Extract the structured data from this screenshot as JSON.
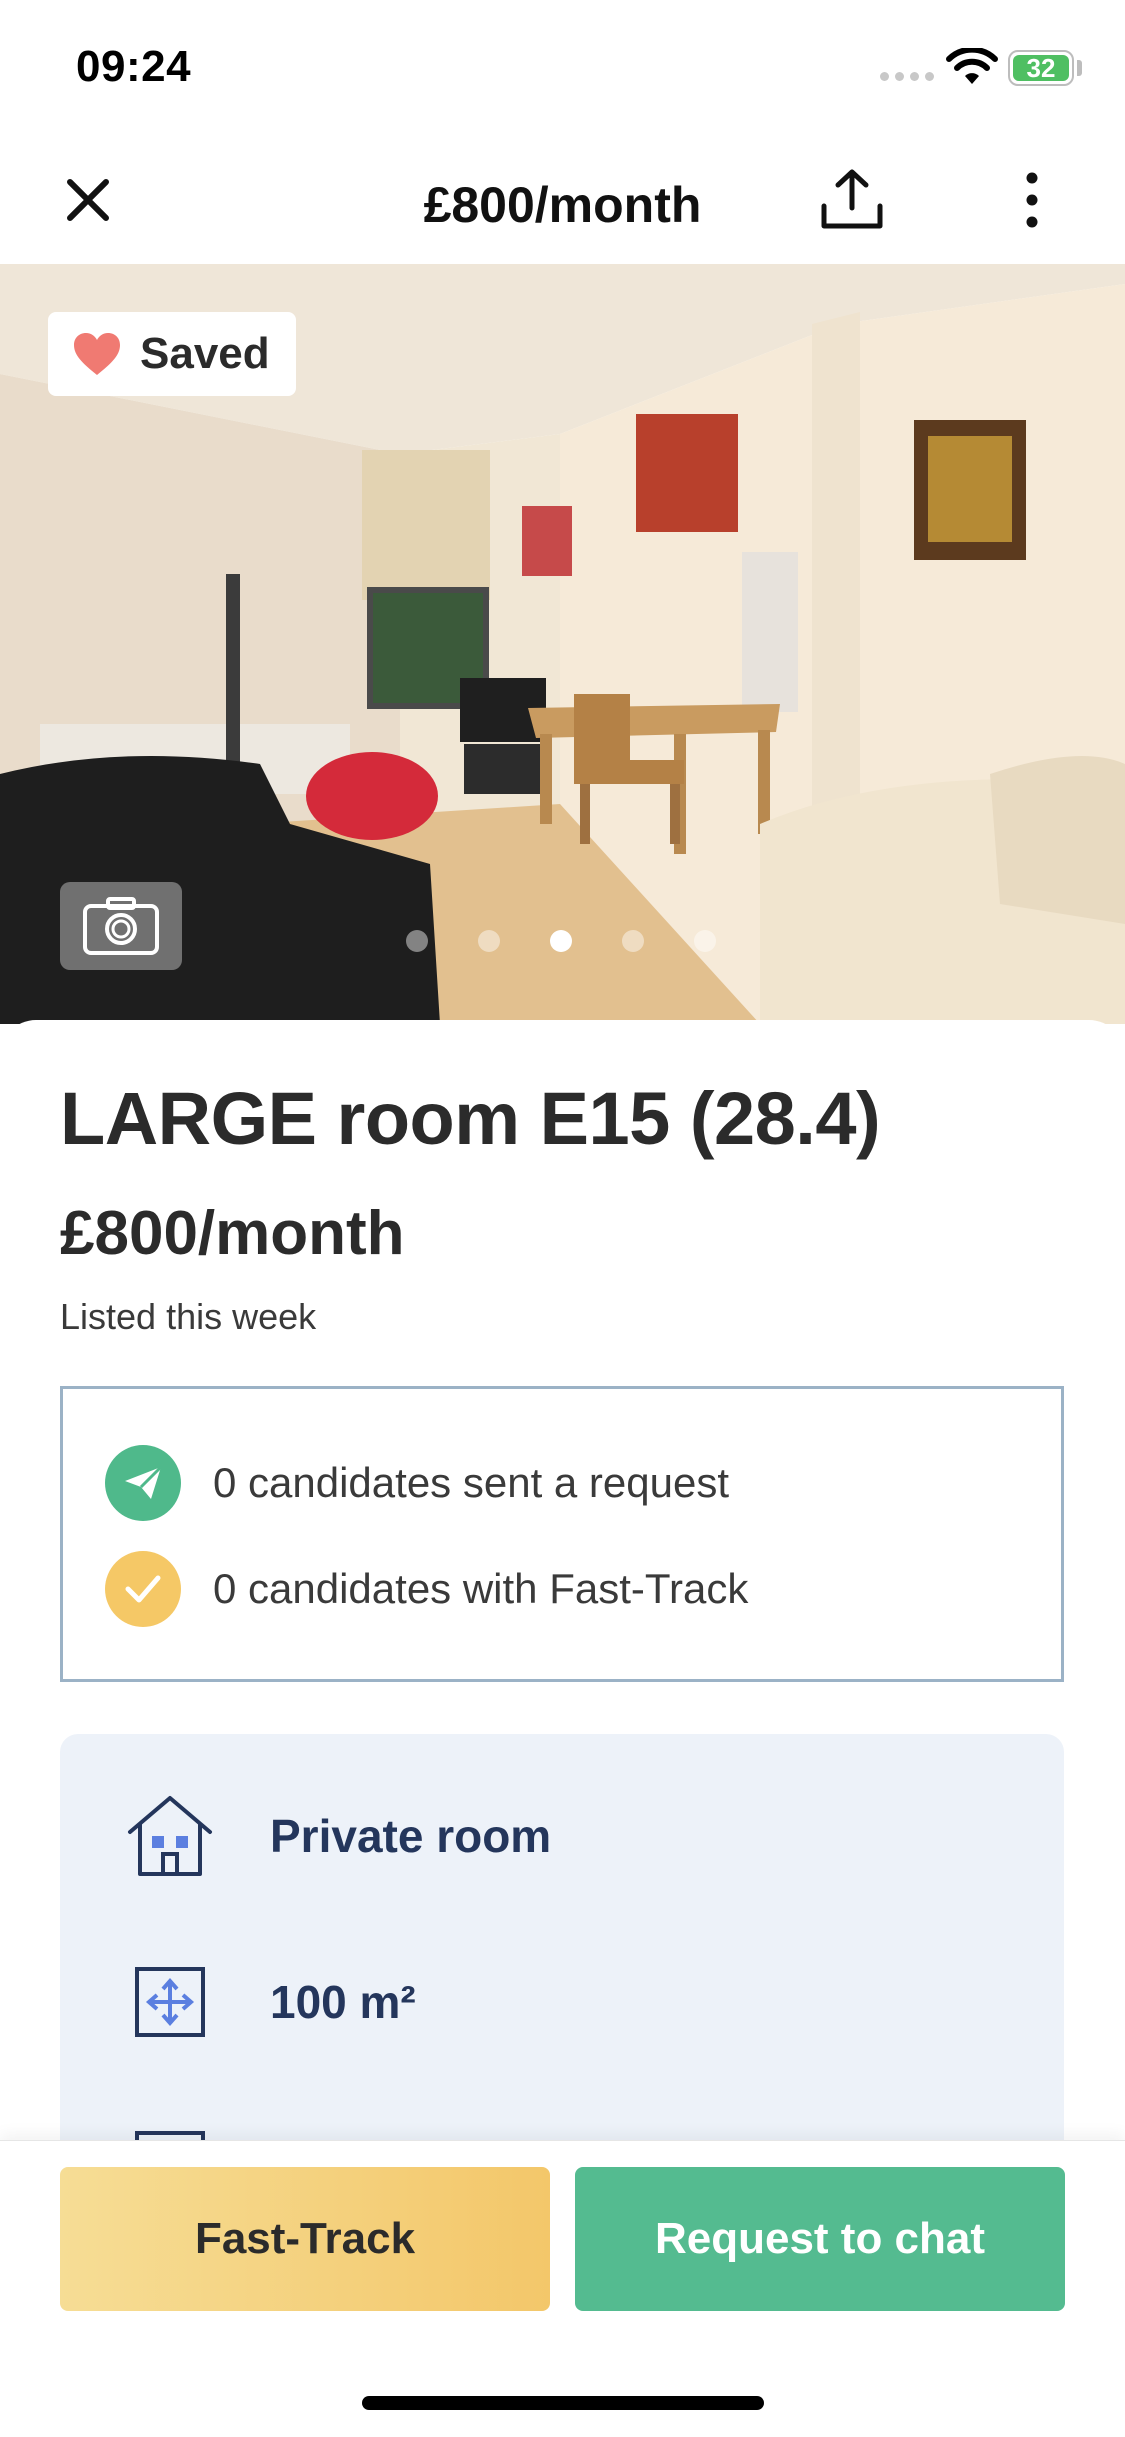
{
  "status_bar": {
    "time": "09:24",
    "battery": "32"
  },
  "nav": {
    "title": "£800/month"
  },
  "photo": {
    "saved_label": "Saved",
    "carousel": {
      "count": 5,
      "active_index": 2
    }
  },
  "listing": {
    "title": "LARGE room E15 (28.4)",
    "price": "£800/month",
    "listed": "Listed this week"
  },
  "stats": [
    {
      "text": "0 candidates sent a request",
      "icon": "paper-plane-icon"
    },
    {
      "text": "0 candidates with Fast-Track",
      "icon": "checkmark-icon"
    }
  ],
  "features": [
    {
      "label": "Private room",
      "icon": "house-icon"
    },
    {
      "label": "100 m²",
      "icon": "area-arrows-icon"
    }
  ],
  "actions": {
    "fast_track": "Fast-Track",
    "request_chat": "Request to chat"
  },
  "colors": {
    "accent_green": "#54bb90",
    "accent_yellow": "#f3c76a",
    "feature_text": "#24365c",
    "heart": "#f07a72"
  }
}
